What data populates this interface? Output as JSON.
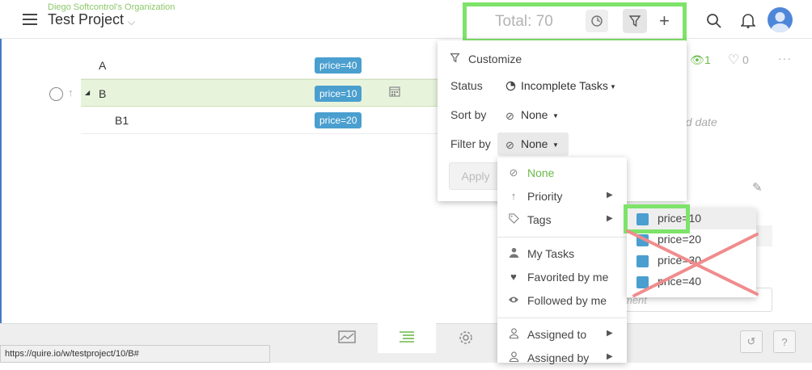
{
  "header": {
    "org": "Diego Softcontrol's Organization",
    "project": "Test Project",
    "total": "Total: 70"
  },
  "tasks": [
    {
      "name": "A",
      "tag": "price=40"
    },
    {
      "name": "B",
      "tag": "price=10"
    },
    {
      "name": "B1",
      "tag": "price=20"
    }
  ],
  "detail": {
    "followers": "1",
    "likes": "0",
    "add_date": "dd date",
    "comment_placeholder": "ment"
  },
  "panel": {
    "title": "Customize",
    "status_label": "Status",
    "status_value": "Incomplete Tasks",
    "sort_label": "Sort by",
    "sort_value": "None",
    "filter_label": "Filter by",
    "filter_value": "None",
    "apply": "Apply"
  },
  "filter_menu": {
    "items": [
      {
        "label": "None",
        "icon": "none-icon"
      },
      {
        "label": "Priority",
        "icon": "arrow-up-icon"
      },
      {
        "label": "Tags",
        "icon": "tag-icon"
      },
      {
        "label": "My Tasks",
        "icon": "user-icon"
      },
      {
        "label": "Favorited by me",
        "icon": "heart-icon"
      },
      {
        "label": "Followed by me",
        "icon": "eye-icon"
      },
      {
        "label": "Assigned to",
        "icon": "user-outline-icon"
      },
      {
        "label": "Assigned by",
        "icon": "user-outline-icon"
      }
    ]
  },
  "tags_menu": {
    "items": [
      "price=10",
      "price=20",
      "price=30",
      "price=40"
    ]
  },
  "status_url": "https://quire.io/w/testproject/10/B#",
  "colors": {
    "accent_green": "#8cc76a",
    "tag_blue": "#4a9fcf",
    "highlight": "#7ee36a",
    "annotation_red": "#f08c8c"
  }
}
